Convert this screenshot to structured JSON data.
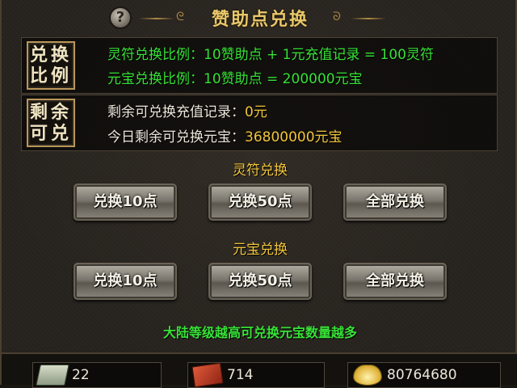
{
  "title": {
    "text": "赞助点兑换",
    "help_icon": "?"
  },
  "rates": {
    "seal": [
      "兑换",
      "比例"
    ],
    "talisman_rate": "灵符兑换比例：10赞助点 + 1元充值记录 = 100灵符",
    "ingot_rate": "元宝兑换比例：10赞助点 = 200000元宝"
  },
  "remaining": {
    "seal": [
      "剩余",
      "可兑"
    ],
    "recharge_label": "剩余可兑换充值记录：",
    "recharge_value": "0元",
    "ingot_label": "今日剩余可兑换元宝：",
    "ingot_value": "36800000元宝"
  },
  "talisman_section": {
    "title": "灵符兑换",
    "buttons": [
      "兑换10点",
      "兑换50点",
      "全部兑换"
    ]
  },
  "ingot_section": {
    "title": "元宝兑换",
    "buttons": [
      "兑换10点",
      "兑换50点",
      "全部兑换"
    ]
  },
  "note": "大陆等级越高可兑换元宝数量越多",
  "currencies": [
    {
      "icon": "cash-stack-icon",
      "value": "22"
    },
    {
      "icon": "red-book-icon",
      "value": "714"
    },
    {
      "icon": "gold-ingot-icon",
      "value": "80764680"
    }
  ],
  "colors": {
    "accent_gold": "#e9c86a",
    "green_text": "#36e236",
    "yellow_text": "#f2c63a"
  }
}
